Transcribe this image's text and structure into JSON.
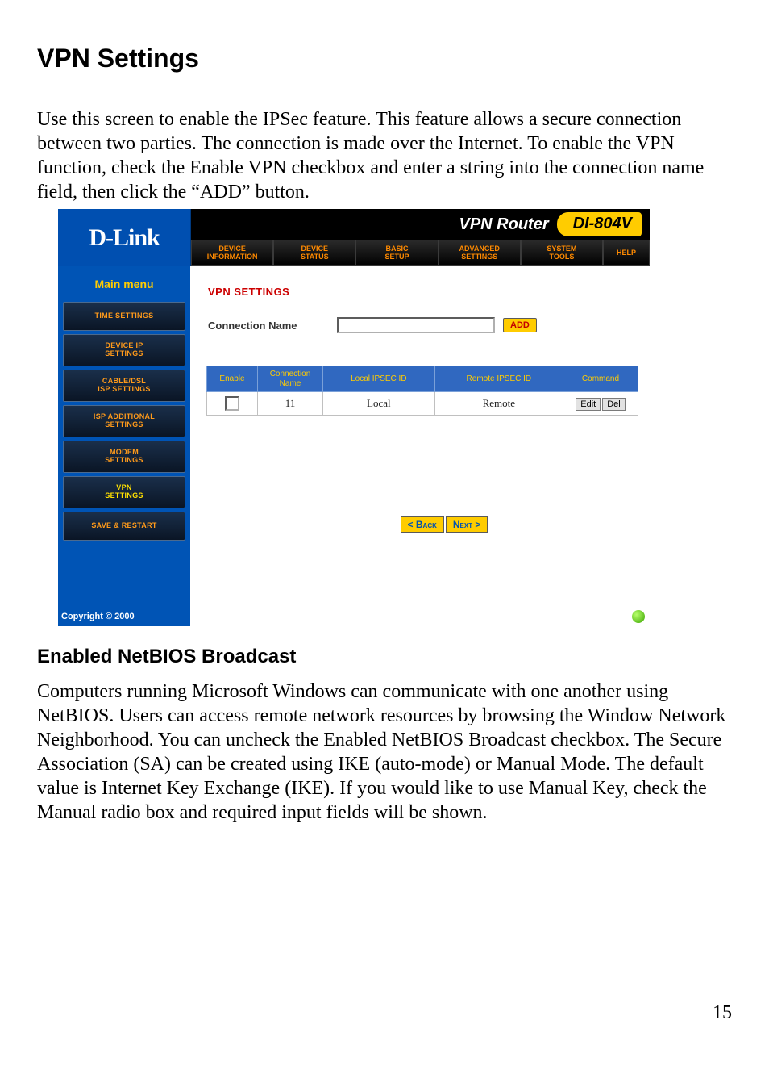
{
  "page": {
    "title": "VPN Settings",
    "intro": "Use this screen to enable the IPSec feature. This feature allows a secure connection between two parties. The connection is made over the Internet. To enable the VPN function, check the Enable VPN checkbox and enter a string into the connection name field, then click the “ADD” button.",
    "section2_heading": "Enabled NetBIOS Broadcast",
    "section2_body": "Computers running Microsoft Windows can communicate with one another using NetBIOS. Users can access remote network resources by browsing the Window Network Neighborhood. You can uncheck the Enabled NetBIOS Broadcast checkbox. The Secure Association (SA) can be created using IKE (auto-mode) or Manual Mode. The default value is Internet Key Exchange (IKE). If you would like to use Manual Key, check the Manual radio box and required input fields will be shown.",
    "page_number": "15"
  },
  "router": {
    "logo_text": "D-Link",
    "title": "VPN Router",
    "model": "DI-804V",
    "topnav": {
      "device_information": "DEVICE\nINFORMATION",
      "device_status": "DEVICE\nSTATUS",
      "basic_setup": "BASIC\nSETUP",
      "advanced_settings": "ADVANCED\nSETTINGS",
      "system_tools": "SYSTEM\nTOOLS",
      "help": "HELP"
    },
    "sidebar": {
      "main_menu": "Main menu",
      "time_settings": "TIME SETTINGS",
      "device_ip": "DEVICE IP\nSETTINGS",
      "cable_dsl": "CABLE/DSL\nISP SETTINGS",
      "isp_additional": "ISP ADDITIONAL\nSETTINGS",
      "modem": "MODEM\nSETTINGS",
      "vpn": "VPN\nSETTINGS",
      "save_restart": "SAVE & RESTART",
      "copyright": "Copyright © 2000"
    },
    "content": {
      "heading": "VPN SETTINGS",
      "connection_label": "Connection Name",
      "connection_value": "",
      "add_button": "ADD",
      "table": {
        "headers": {
          "enable": "Enable",
          "connection_name": "Connection\nName",
          "local_ipsec": "Local IPSEC ID",
          "remote_ipsec": "Remote IPSEC ID",
          "command": "Command"
        },
        "row": {
          "connection_name": "11",
          "local_ipsec": "Local",
          "remote_ipsec": "Remote",
          "edit": "Edit",
          "del": "Del"
        }
      },
      "back": "< Back",
      "next": "Next >"
    }
  }
}
